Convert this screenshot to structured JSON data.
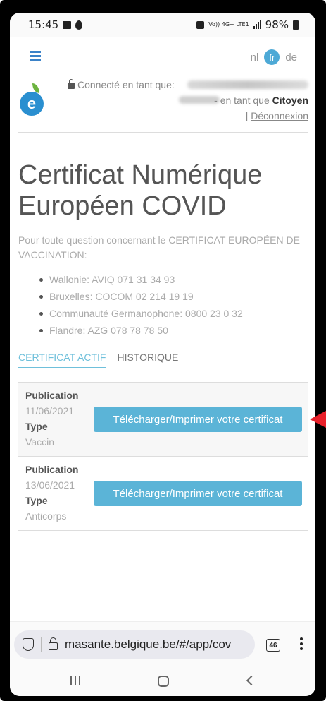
{
  "status_bar": {
    "time": "15:45",
    "network": "Vo)) 4G+ LTE1",
    "battery": "98%"
  },
  "nav": {
    "languages": [
      "nl",
      "fr",
      "de"
    ],
    "active_language": "fr"
  },
  "user": {
    "connected_as": "Connecté en tant que:",
    "role_prefix": "- en tant que",
    "role": "Citoyen",
    "separator": "|",
    "logout": "Déconnexion"
  },
  "page": {
    "title": "Certificat Numérique Européen COVID",
    "intro": "Pour toute question concernant le CERTIFICAT EUROPÉEN DE VACCINATION:",
    "contacts": [
      "Wallonie: AVIQ 071 31 34 93",
      "Bruxelles: COCOM 02 214 19 19",
      "Communauté Germanophone: 0800 23 0 32",
      "Flandre: AZG 078 78 78 50"
    ]
  },
  "tabs": {
    "active": "CERTIFICAT ACTIF",
    "history": "HISTORIQUE"
  },
  "certificates": [
    {
      "publication_label": "Publication",
      "date": "11/06/2021",
      "type_label": "Type",
      "type": "Vaccin",
      "button": "Télécharger/Imprimer votre certificat"
    },
    {
      "publication_label": "Publication",
      "date": "13/06/2021",
      "type_label": "Type",
      "type": "Anticorps",
      "button": "Télécharger/Imprimer votre certificat"
    }
  ],
  "browser": {
    "url": "masante.belgique.be/#/app/cov",
    "tab_count": "46"
  },
  "colors": {
    "accent": "#5bb4d7",
    "link_blue": "#3b82c8",
    "annotation_arrow": "#e8202a"
  }
}
